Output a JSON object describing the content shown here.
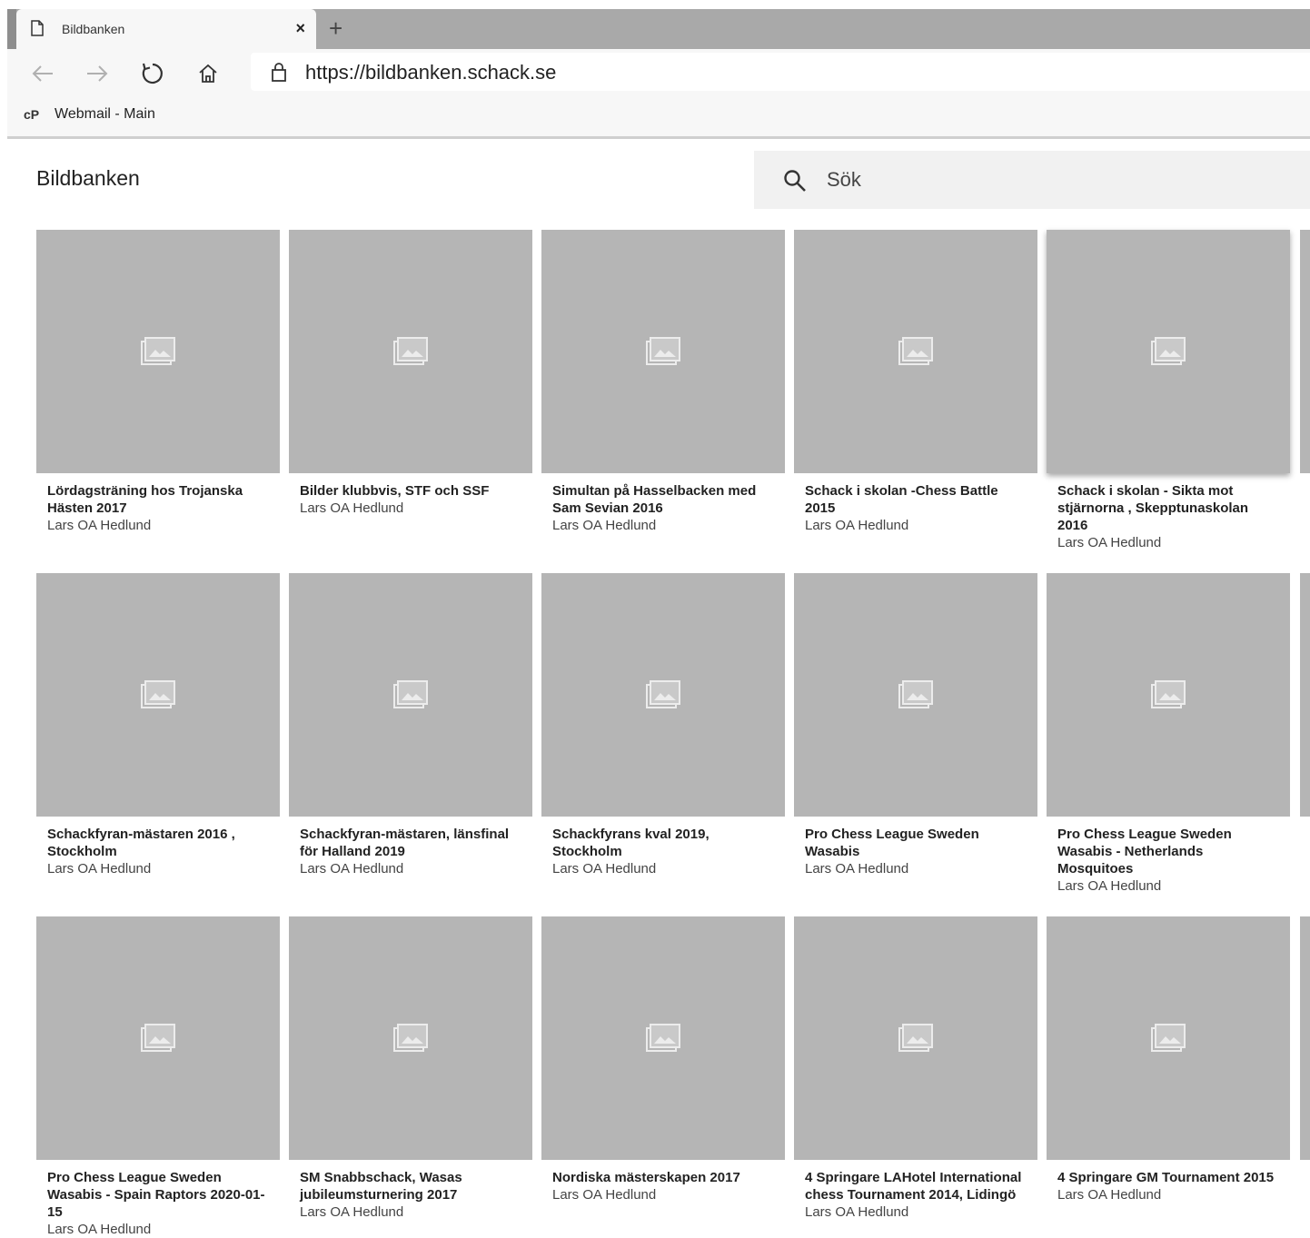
{
  "browser": {
    "tab_title": "Bildbanken",
    "tab_close": "×",
    "new_tab": "+",
    "url": "https://bildbanken.schack.se",
    "bookmark_icon": "cP",
    "bookmark_label": "Webmail - Main"
  },
  "page": {
    "title": "Bildbanken",
    "search_placeholder": "Sök"
  },
  "albums": [
    {
      "title": "Lördagsträning hos Trojanska Hästen 2017",
      "author": "Lars OA Hedlund"
    },
    {
      "title": "Bilder klubbvis, STF och SSF",
      "author": "Lars OA Hedlund"
    },
    {
      "title": "Simultan på Hasselbacken med Sam Sevian 2016",
      "author": "Lars OA Hedlund"
    },
    {
      "title": "Schack i skolan -Chess Battle 2015",
      "author": "Lars OA Hedlund"
    },
    {
      "title": "Schack i skolan - Sikta mot stjärnorna , Skepptunaskolan 2016",
      "author": "Lars OA Hedlund"
    },
    {
      "title": "Schackfyran-mästaren 2016 , Stockholm",
      "author": "Lars OA Hedlund"
    },
    {
      "title": "Schackfyran-mästaren, länsfinal för Halland 2019",
      "author": "Lars OA Hedlund"
    },
    {
      "title": "Schackfyrans kval 2019, Stockholm",
      "author": "Lars OA Hedlund"
    },
    {
      "title": "Pro Chess League Sweden Wasabis",
      "author": "Lars OA Hedlund"
    },
    {
      "title": "Pro Chess League Sweden Wasabis - Netherlands Mosquitoes",
      "author": "Lars OA Hedlund"
    },
    {
      "title": "Pro Chess League Sweden Wasabis - Spain Raptors 2020-01-15",
      "author": "Lars OA Hedlund"
    },
    {
      "title": "SM Snabbschack, Wasas jubileumsturnering 2017",
      "author": "Lars OA Hedlund"
    },
    {
      "title": "Nordiska mästerskapen 2017",
      "author": "Lars OA Hedlund"
    },
    {
      "title": "4 Springare LAHotel International chess Tournament 2014, Lidingö",
      "author": "Lars OA Hedlund"
    },
    {
      "title": "4 Springare GM Tournament 2015",
      "author": "Lars OA Hedlund"
    }
  ],
  "colors": {
    "thumbnail": "#b5b5b5",
    "tabstrip": "#a9a9a9",
    "toolbar": "#f7f7f7",
    "search_bg": "#f1f1f1"
  },
  "icons": {
    "tab": "page-icon",
    "back": "arrow-left-icon",
    "forward": "arrow-right-icon",
    "refresh": "refresh-icon",
    "home": "home-icon",
    "lock": "lock-icon",
    "search": "search-icon",
    "thumbnail": "photo-placeholder-icon"
  }
}
